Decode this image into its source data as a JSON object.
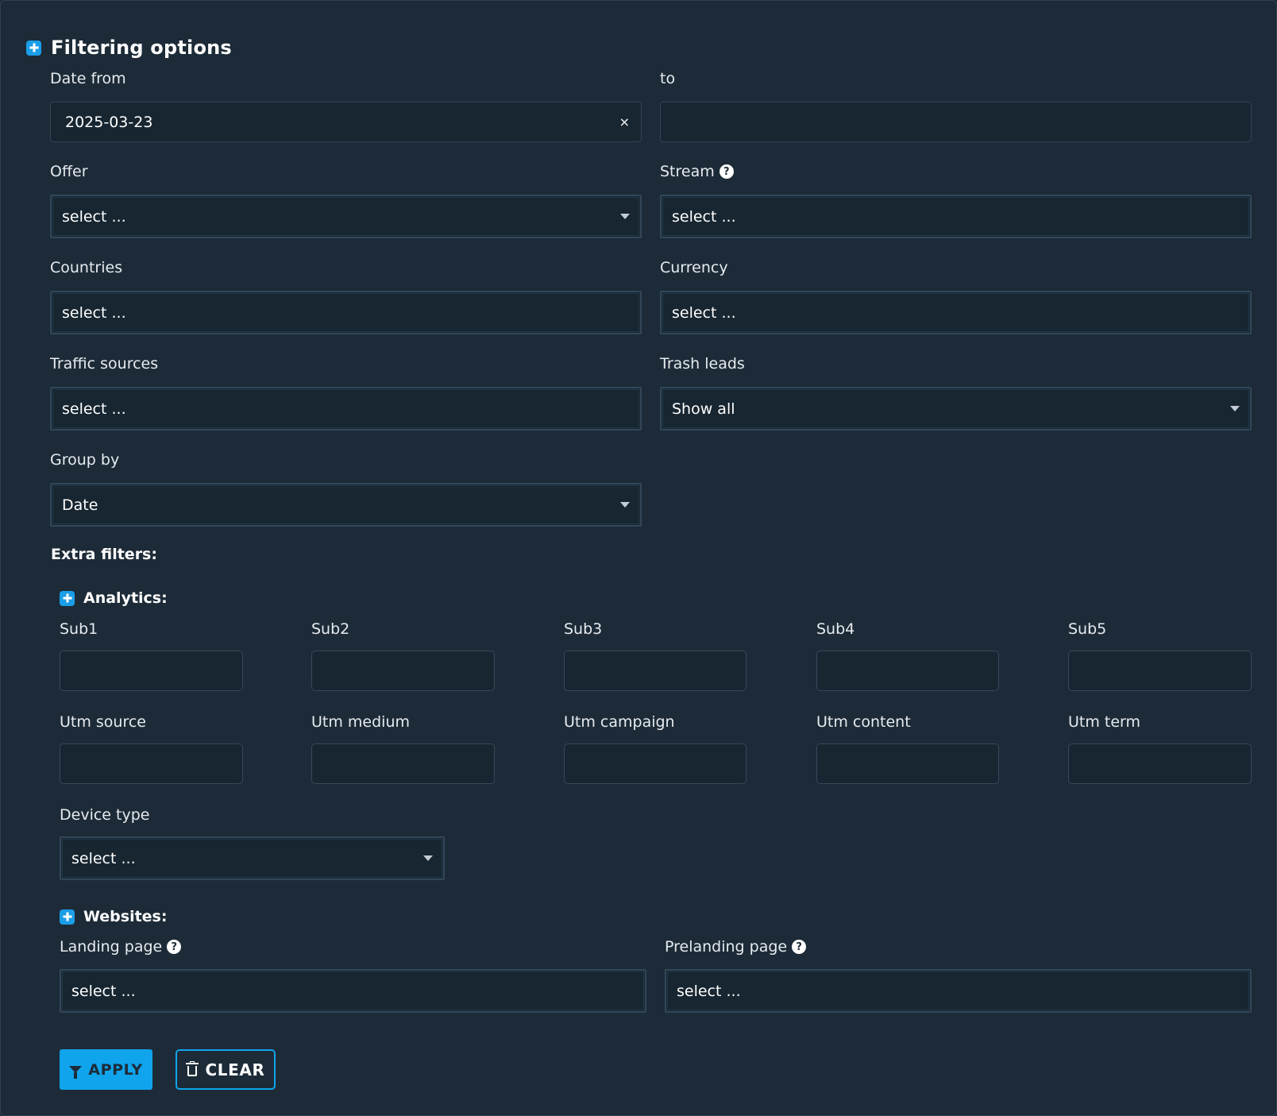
{
  "header": {
    "title": "Filtering options"
  },
  "date": {
    "from_label": "Date from",
    "from_value": "2025-03-23",
    "to_label": "to",
    "to_value": ""
  },
  "offer": {
    "label": "Offer",
    "value": "select ..."
  },
  "stream": {
    "label": "Stream",
    "value": "select ..."
  },
  "countries": {
    "label": "Countries",
    "value": "select ..."
  },
  "currency": {
    "label": "Currency",
    "value": "select ..."
  },
  "traffic_sources": {
    "label": "Traffic sources",
    "value": "select ..."
  },
  "trash_leads": {
    "label": "Trash leads",
    "value": "Show all"
  },
  "group_by": {
    "label": "Group by",
    "value": "Date"
  },
  "extra": {
    "title": "Extra filters:"
  },
  "analytics": {
    "title": "Analytics:",
    "subs": [
      "Sub1",
      "Sub2",
      "Sub3",
      "Sub4",
      "Sub5"
    ],
    "utms": [
      "Utm source",
      "Utm medium",
      "Utm campaign",
      "Utm content",
      "Utm term"
    ],
    "device_type_label": "Device type",
    "device_type_value": "select ..."
  },
  "websites": {
    "title": "Websites:",
    "landing_label": "Landing page",
    "landing_value": "select ...",
    "prelanding_label": "Prelanding page",
    "prelanding_value": "select ..."
  },
  "buttons": {
    "apply": "APPLY",
    "clear": "CLEAR"
  },
  "colors": {
    "background": "#1d2b38",
    "field": "#172631",
    "accent": "#10a4ec"
  },
  "icons": [
    "plus-icon",
    "help-icon",
    "caret-icon",
    "clear-icon",
    "funnel-icon",
    "trash-icon"
  ]
}
